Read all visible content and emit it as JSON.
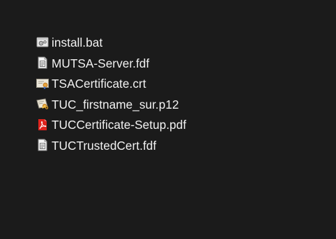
{
  "explorer": {
    "files": [
      {
        "name": "install.bat",
        "icon": "batch-file-icon"
      },
      {
        "name": "MUTSA-Server.fdf",
        "icon": "fdf-document-icon"
      },
      {
        "name": "TSACertificate.crt",
        "icon": "certificate-icon"
      },
      {
        "name": "TUC_firstname_sur.p12",
        "icon": "personal-certificate-icon"
      },
      {
        "name": "TUCCertificate-Setup.pdf",
        "icon": "pdf-icon"
      },
      {
        "name": "TUCTrustedCert.fdf",
        "icon": "fdf-document-icon"
      }
    ],
    "colors": {
      "background": "#1b1b1b",
      "text": "#f2f2f2",
      "pdf_accent": "#e0231d",
      "cert_accent": "#e8a33c"
    }
  }
}
